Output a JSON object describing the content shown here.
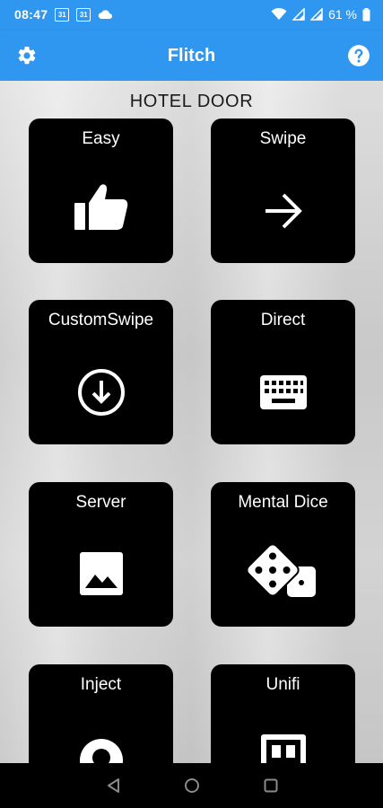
{
  "status_bar": {
    "time": "08:47",
    "badge_one": "31",
    "badge_two": "31",
    "battery_text": "61 %"
  },
  "app_bar": {
    "title": "Flitch"
  },
  "section": {
    "title": "HOTEL DOOR"
  },
  "tiles": [
    {
      "label": "Easy",
      "icon": "thumbs-up-icon"
    },
    {
      "label": "Swipe",
      "icon": "arrow-right-icon"
    },
    {
      "label": "CustomSwipe",
      "icon": "arrow-down-circle-icon"
    },
    {
      "label": "Direct",
      "icon": "keyboard-icon"
    },
    {
      "label": "Server",
      "icon": "image-icon"
    },
    {
      "label": "Mental Dice",
      "icon": "dice-icon"
    },
    {
      "label": "Inject",
      "icon": "inject-icon"
    },
    {
      "label": "Unifi",
      "icon": "unifi-icon"
    }
  ],
  "colors": {
    "app_bar": "#2f97ef",
    "tile": "#000000",
    "tile_text": "#ffffff"
  }
}
